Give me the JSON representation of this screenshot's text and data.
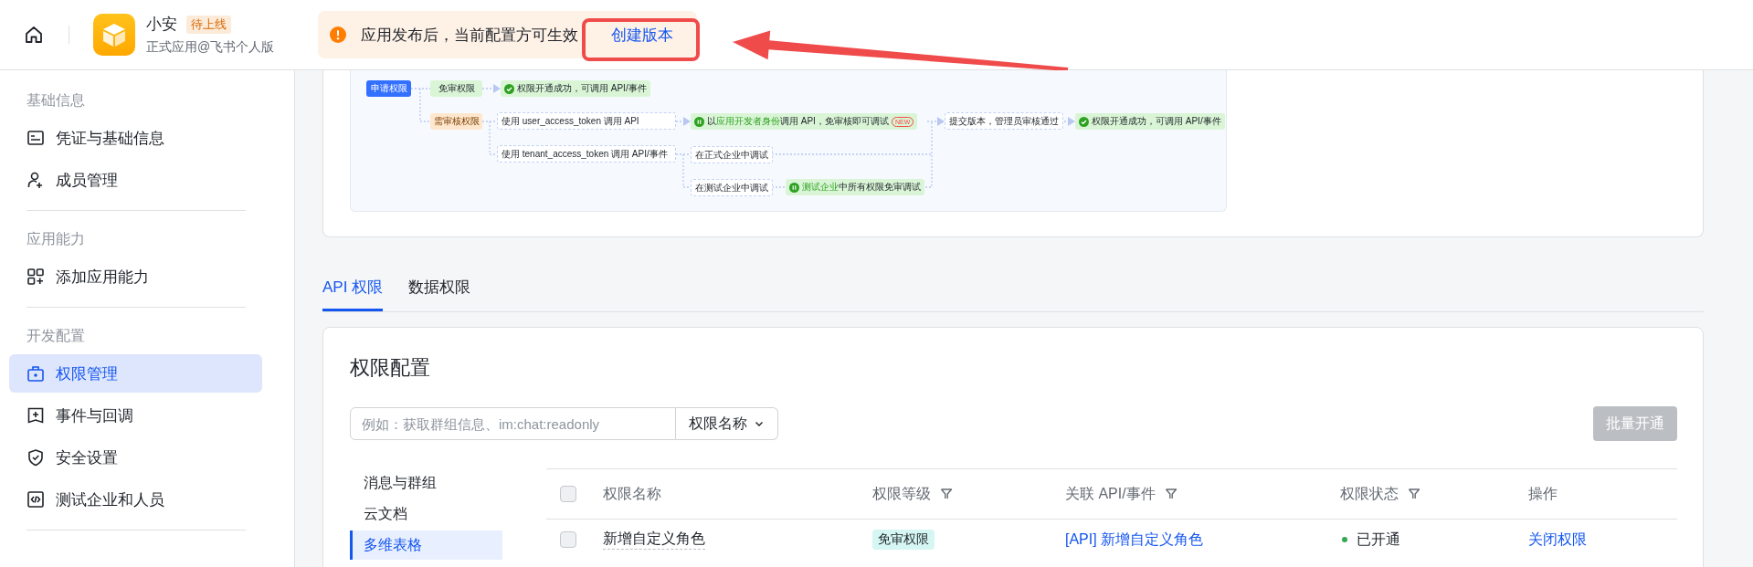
{
  "header": {
    "app_name": "小安",
    "status_badge": "待上线",
    "subtitle": "正式应用@飞书个人版",
    "notice": {
      "message": "应用发布后，当前配置方可生效",
      "action": "创建版本"
    }
  },
  "sidebar": {
    "sections": [
      {
        "title": "基础信息",
        "items": [
          {
            "label": "凭证与基础信息",
            "selected": false
          },
          {
            "label": "成员管理",
            "selected": false
          }
        ]
      },
      {
        "title": "应用能力",
        "items": [
          {
            "label": "添加应用能力",
            "selected": false
          }
        ]
      },
      {
        "title": "开发配置",
        "items": [
          {
            "label": "权限管理",
            "selected": true
          },
          {
            "label": "事件与回调",
            "selected": false
          },
          {
            "label": "安全设置",
            "selected": false
          },
          {
            "label": "测试企业和人员",
            "selected": false
          }
        ]
      }
    ]
  },
  "flow_diagram": {
    "nodes": [
      {
        "kind": "start",
        "parts": [
          {
            "text": "申请权限"
          }
        ]
      },
      {
        "kind": "green",
        "parts": [
          {
            "text": "免审权限"
          }
        ]
      },
      {
        "kind": "success",
        "parts": [
          {
            "text": "权限开通成功，可调用 API/事件"
          }
        ]
      },
      {
        "kind": "orange",
        "parts": [
          {
            "text": "需审核权限"
          }
        ]
      },
      {
        "kind": "step",
        "parts": [
          {
            "text": "使用 user_access_token 调用 API"
          }
        ]
      },
      {
        "kind": "info",
        "parts": [
          {
            "text": "以"
          },
          {
            "text": "应用开发者身份",
            "highlight": true
          },
          {
            "text": "调用 API，免审核即可调试"
          }
        ],
        "badge": "NEW"
      },
      {
        "kind": "step",
        "parts": [
          {
            "text": "使用 tenant_access_token 调用 API/事件"
          }
        ]
      },
      {
        "kind": "step",
        "parts": [
          {
            "text": "在正式企业中调试"
          }
        ]
      },
      {
        "kind": "step",
        "parts": [
          {
            "text": "在测试企业中调试"
          }
        ]
      },
      {
        "kind": "info",
        "parts": [
          {
            "text": "测试企业",
            "highlight": true
          },
          {
            "text": "中所有权限免审调试"
          }
        ]
      },
      {
        "kind": "step",
        "parts": [
          {
            "text": "提交版本，管理员审核通过"
          }
        ]
      },
      {
        "kind": "success",
        "parts": [
          {
            "text": "权限开通成功，可调用 API/事件"
          }
        ]
      }
    ]
  },
  "tabs": [
    {
      "label": "API 权限",
      "selected": true
    },
    {
      "label": "数据权限",
      "selected": false
    }
  ],
  "permission_config": {
    "title": "权限配置",
    "search": {
      "placeholder": "例如：获取群组信息、im:chat:readonly"
    },
    "search_scope": "权限名称",
    "bulk_button": {
      "label": "批量开通",
      "disabled": true
    },
    "categories": [
      {
        "label": "消息与群组",
        "selected": false
      },
      {
        "label": "云文档",
        "selected": false
      },
      {
        "label": "多维表格",
        "selected": true
      }
    ],
    "table": {
      "select_all_checked": false,
      "columns": [
        {
          "label": "权限名称",
          "filterable": false
        },
        {
          "label": "权限等级",
          "filterable": true
        },
        {
          "label": "关联 API/事件",
          "filterable": true
        },
        {
          "label": "权限状态",
          "filterable": true
        },
        {
          "label": "操作",
          "filterable": false
        }
      ],
      "rows": [
        {
          "checked": false,
          "name": "新增自定义角色",
          "level_tag": "免审权限",
          "api": "[API] 新增自定义角色",
          "status": "已开通",
          "color": "#34a853",
          "action": "关闭权限"
        }
      ]
    }
  }
}
